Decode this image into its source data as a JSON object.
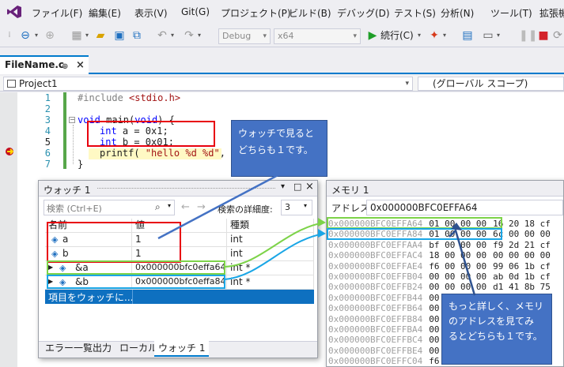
{
  "menu": [
    "ファイル(F)",
    "編集(E)",
    "表示(V)",
    "Git(G)",
    "プロジェクト(P)",
    "ビルド(B)",
    "デバッグ(D)",
    "テスト(S)",
    "分析(N)",
    "ツール(T)",
    "拡張機"
  ],
  "toolbar": {
    "config": "Debug",
    "platform": "x64",
    "continue_label": "続行(C)"
  },
  "editor": {
    "tab_title": "FileName.c",
    "tab_pin": "⊕",
    "tab_close": "×",
    "project": "Project1",
    "scope": "(グローバル スコープ)",
    "line_numbers": [
      "1",
      "2",
      "3",
      "4",
      "5",
      "6",
      "7"
    ],
    "lines": {
      "l1_pp": "#include ",
      "l1_hdr": "<stdio.h>",
      "l3_kw": "void",
      "l3_fn": " main(",
      "l3_kw2": "void",
      "l3_end": ") {",
      "l4_kw": "int",
      "l4_rest": " a = 0x1;",
      "l5_kw": "int",
      "l5_rest": " b = 0x01;",
      "l6_fn": "printf( ",
      "l6_str": "\"hello %d %d\"",
      "l6_rest": ", a",
      "l7": "}"
    }
  },
  "callouts": {
    "watch_note": "ウォッチで見ると\nどちらも１です。",
    "memory_note": "もっと詳しく、メモリ\nのアドレスを見てみ\nるとどちらも１です。"
  },
  "watch": {
    "title": "ウォッチ 1",
    "search_placeholder": "検索 (Ctrl+E)",
    "search_depth_label": "検索の詳細度:",
    "search_depth_value": "3",
    "headers": [
      "名前",
      "値",
      "種類"
    ],
    "rows": [
      {
        "name": "a",
        "value": "1",
        "type": "int"
      },
      {
        "name": "b",
        "value": "1",
        "type": "int"
      },
      {
        "name": "&a",
        "value": "0x000000bfc0effa64 ...",
        "type": "int *"
      },
      {
        "name": "&b",
        "value": "0x000000bfc0effa84 ...",
        "type": "int *"
      }
    ],
    "add_item": "項目をウォッチに...",
    "bottom_tabs": [
      "エラー一覧",
      "出力",
      "ローカル",
      "ウォッチ 1"
    ]
  },
  "memory": {
    "title": "メモリ 1",
    "address_label": "アドレス:",
    "address_value": "0x000000BFC0EFFA64",
    "rows": [
      {
        "addr": "0x000000BFC0EFFA64",
        "bytes": "01 00 00 00",
        "tail": "16 20 18 cf"
      },
      {
        "addr": "0x000000BFC0EFFA84",
        "bytes": "01 00 00 00",
        "tail": "6c 00 00 00"
      },
      {
        "addr": "0x000000BFC0EFFAA4",
        "bytes": "bf 00 00 00",
        "tail": "f9 2d 21 cf"
      },
      {
        "addr": "0x000000BFC0EFFAC4",
        "bytes": "18 00 00 00",
        "tail": "00 00 00 00"
      },
      {
        "addr": "0x000000BFC0EFFAE4",
        "bytes": "f6 00 00 00",
        "tail": "99 06 1b cf"
      },
      {
        "addr": "0x000000BFC0EFFB04",
        "bytes": "00 00 00 00",
        "tail": "ab 0d 1b cf"
      },
      {
        "addr": "0x000000BFC0EFFB24",
        "bytes": "00 00 00 00",
        "tail": "d1 41 8b 75"
      },
      {
        "addr": "0x000000BFC0EFFB44",
        "bytes": "00 00 00 00",
        "tail": "00 00 00 00"
      },
      {
        "addr": "0x000000BFC0EFFB64",
        "bytes": "00 00 00 00",
        "tail": "00 00 00 00"
      },
      {
        "addr": "0x000000BFC0EFFB84",
        "bytes": "00 00 00 00",
        "tail": "00 00 00 00"
      },
      {
        "addr": "0x000000BFC0EFFBA4",
        "bytes": "00 00 00 00",
        "tail": "00 00 00 00"
      },
      {
        "addr": "0x000000BFC0EFFBC4",
        "bytes": "00 00 00 00",
        "tail": "00 00 00 00"
      },
      {
        "addr": "0x000000BFC0EFFBE4",
        "bytes": "00 00 00 00",
        "tail": "00 00 00 00"
      },
      {
        "addr": "0x000000BFC0EFFC04",
        "bytes": "f6 7f 00 00",
        "tail": "00 00 00 00"
      }
    ]
  },
  "colors": {
    "accent": "#007acc",
    "highlight_red": "#e8000d",
    "callout_blue": "#4472c4",
    "match_green": "#7dd349",
    "match_cyan": "#1aa6e6",
    "selection": "#0e70c0"
  }
}
